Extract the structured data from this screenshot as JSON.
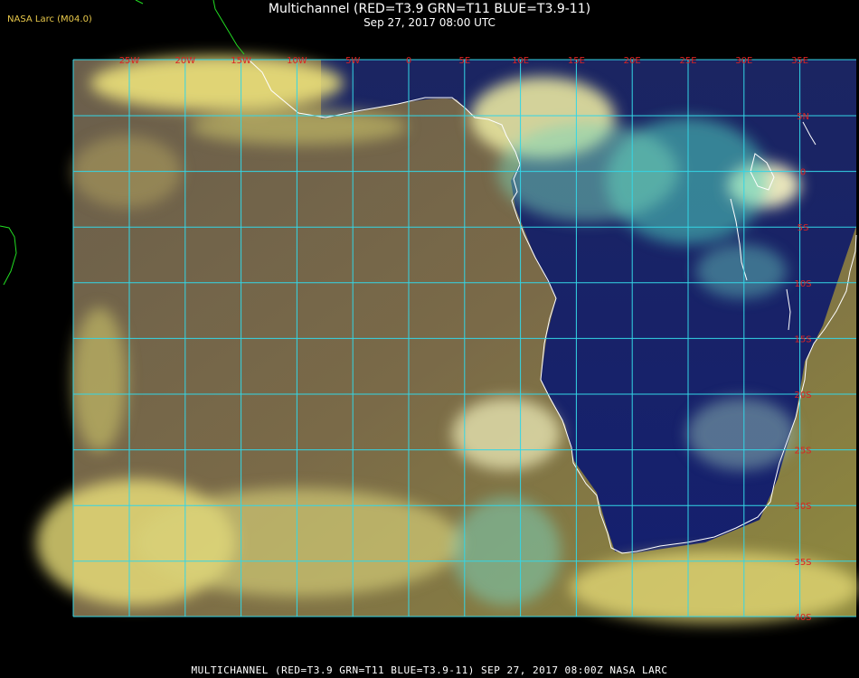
{
  "brand": "NASA Larc (M04.0)",
  "title": "Multichannel (RED=T3.9 GRN=T11 BLUE=T3.9-11)",
  "subtitle": "Sep 27, 2017 08:00 UTC",
  "footer": "MULTICHANNEL (RED=T3.9 GRN=T11 BLUE=T3.9-11) SEP 27, 2017 08:00Z   NASA LARC",
  "colors": {
    "grid": "#33d6e6",
    "coast": "#ffffff",
    "border": "#22dd22",
    "labels": "#dd2222",
    "ocean_cloudfree": "#6b5a4a",
    "cloud": "#ece17a",
    "land": "#1a2466"
  },
  "grid": {
    "lon_labels": [
      "25W",
      "20W",
      "15W",
      "10W",
      "5W",
      "0",
      "5E",
      "10E",
      "15E",
      "20E",
      "25E",
      "30E",
      "35E"
    ],
    "lat_labels": [
      "5N",
      "0",
      "5S",
      "10S",
      "15S",
      "20S",
      "25S",
      "30S",
      "35S",
      "40S"
    ]
  }
}
